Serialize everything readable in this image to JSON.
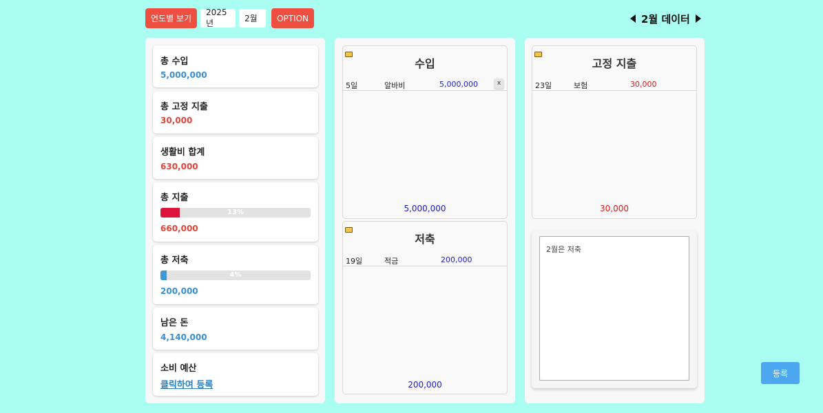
{
  "topbar": {
    "yearly_view_label": "연도별 보기",
    "year_value": "2025년",
    "month_value": "2월",
    "option_label": "OPTION"
  },
  "month_nav": {
    "title": "2월 데이터"
  },
  "summary": {
    "total_income": {
      "label": "총 수입",
      "value": "5,000,000"
    },
    "total_fixed": {
      "label": "총 고정 지출",
      "value": "30,000"
    },
    "living_total": {
      "label": "생활비 합계",
      "value": "630,000"
    },
    "total_expense": {
      "label": "총 지출",
      "value": "660,000",
      "percent_label": "13%",
      "percent": 13
    },
    "total_saving": {
      "label": "총 저축",
      "value": "200,000",
      "percent_label": "4%",
      "percent": 4
    },
    "remaining": {
      "label": "남은 돈",
      "value": "4,140,000"
    },
    "budget": {
      "label": "소비 예산",
      "link": "클릭하여 등록"
    }
  },
  "income": {
    "title": "수입",
    "rows": [
      {
        "day": "5일",
        "name": "알바비",
        "amount": "5,000,000",
        "delete": "x"
      }
    ],
    "total": "5,000,000"
  },
  "savings": {
    "title": "저축",
    "rows": [
      {
        "day": "19일",
        "name": "적금",
        "amount": "200,000"
      }
    ],
    "total": "200,000"
  },
  "fixed": {
    "title": "고정 지출",
    "rows": [
      {
        "day": "23일",
        "name": "보험",
        "amount": "30,000"
      }
    ],
    "total": "30,000"
  },
  "memo": {
    "text": "2월은 저축"
  },
  "register_label": "등록",
  "colors": {
    "background": "#aafdf1",
    "accent_red": "#ef4f40",
    "expense_bar": "#dc143c",
    "saving_bar": "#3a9ad9",
    "register_button": "#4da6f0"
  }
}
